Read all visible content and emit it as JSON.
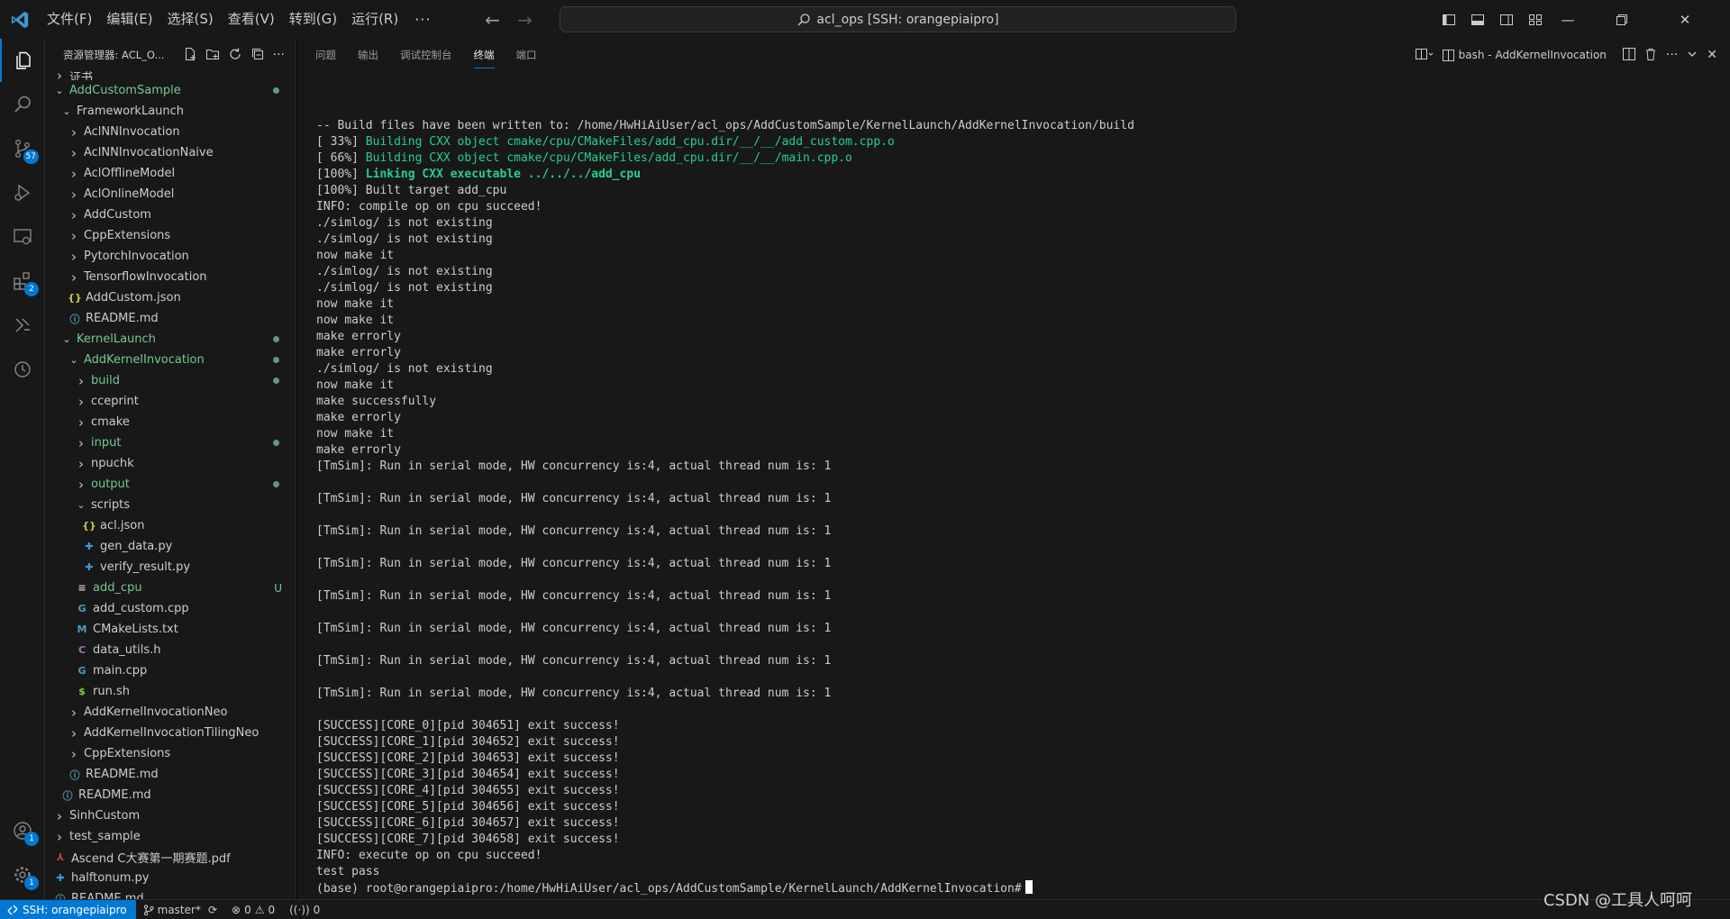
{
  "titlebar": {
    "menus": [
      "文件(F)",
      "编辑(E)",
      "选择(S)",
      "查看(V)",
      "转到(G)",
      "运行(R)"
    ],
    "more": "···",
    "search_text": "acl_ops [SSH: orangepiaipro]"
  },
  "activity": {
    "scm_badge": "57",
    "extensions_badge": "2",
    "accounts_badge": "1",
    "settings_badge": "1"
  },
  "sidebar": {
    "title": "资源管理器: ACL_O...",
    "items": [
      {
        "label": "证书",
        "depth": 1,
        "type": "folder-closed",
        "color": "",
        "mark": ""
      },
      {
        "label": "AddCustomSample",
        "depth": 1,
        "type": "folder-open",
        "color": "green",
        "mark": "dot"
      },
      {
        "label": "FrameworkLaunch",
        "depth": 2,
        "type": "folder-open",
        "color": "",
        "mark": ""
      },
      {
        "label": "AclNNInvocation",
        "depth": 3,
        "type": "folder-closed",
        "color": "",
        "mark": ""
      },
      {
        "label": "AclNNInvocationNaive",
        "depth": 3,
        "type": "folder-closed",
        "color": "",
        "mark": ""
      },
      {
        "label": "AclOfflineModel",
        "depth": 3,
        "type": "folder-closed",
        "color": "",
        "mark": ""
      },
      {
        "label": "AclOnlineModel",
        "depth": 3,
        "type": "folder-closed",
        "color": "",
        "mark": ""
      },
      {
        "label": "AddCustom",
        "depth": 3,
        "type": "folder-closed",
        "color": "",
        "mark": ""
      },
      {
        "label": "CppExtensions",
        "depth": 3,
        "type": "folder-closed",
        "color": "",
        "mark": ""
      },
      {
        "label": "PytorchInvocation",
        "depth": 3,
        "type": "folder-closed",
        "color": "",
        "mark": ""
      },
      {
        "label": "TensorflowInvocation",
        "depth": 3,
        "type": "folder-closed",
        "color": "",
        "mark": ""
      },
      {
        "label": "AddCustom.json",
        "depth": 3,
        "type": "json",
        "color": "",
        "mark": ""
      },
      {
        "label": "README.md",
        "depth": 3,
        "type": "info",
        "color": "",
        "mark": ""
      },
      {
        "label": "KernelLaunch",
        "depth": 2,
        "type": "folder-open",
        "color": "green",
        "mark": "dot"
      },
      {
        "label": "AddKernelInvocation",
        "depth": 3,
        "type": "folder-open",
        "color": "green",
        "mark": "dot"
      },
      {
        "label": "build",
        "depth": 4,
        "type": "folder-closed",
        "color": "green",
        "mark": "dot"
      },
      {
        "label": "cceprint",
        "depth": 4,
        "type": "folder-closed",
        "color": "",
        "mark": ""
      },
      {
        "label": "cmake",
        "depth": 4,
        "type": "folder-closed",
        "color": "",
        "mark": ""
      },
      {
        "label": "input",
        "depth": 4,
        "type": "folder-closed",
        "color": "green",
        "mark": "dot"
      },
      {
        "label": "npuchk",
        "depth": 4,
        "type": "folder-closed",
        "color": "",
        "mark": ""
      },
      {
        "label": "output",
        "depth": 4,
        "type": "folder-closed",
        "color": "green",
        "mark": "dot"
      },
      {
        "label": "scripts",
        "depth": 4,
        "type": "folder-open",
        "color": "",
        "mark": ""
      },
      {
        "label": "acl.json",
        "depth": 5,
        "type": "json",
        "color": "",
        "mark": ""
      },
      {
        "label": "gen_data.py",
        "depth": 5,
        "type": "python",
        "color": "",
        "mark": ""
      },
      {
        "label": "verify_result.py",
        "depth": 5,
        "type": "python",
        "color": "",
        "mark": ""
      },
      {
        "label": "add_cpu",
        "depth": 4,
        "type": "text",
        "color": "green",
        "mark": "U"
      },
      {
        "label": "add_custom.cpp",
        "depth": 4,
        "type": "cpp",
        "color": "",
        "mark": ""
      },
      {
        "label": "CMakeLists.txt",
        "depth": 4,
        "type": "cmake",
        "color": "",
        "mark": ""
      },
      {
        "label": "data_utils.h",
        "depth": 4,
        "type": "c",
        "color": "",
        "mark": ""
      },
      {
        "label": "main.cpp",
        "depth": 4,
        "type": "cpp",
        "color": "",
        "mark": ""
      },
      {
        "label": "run.sh",
        "depth": 4,
        "type": "shell",
        "color": "",
        "mark": ""
      },
      {
        "label": "AddKernelInvocationNeo",
        "depth": 3,
        "type": "folder-closed",
        "color": "",
        "mark": ""
      },
      {
        "label": "AddKernelInvocationTilingNeo",
        "depth": 3,
        "type": "folder-closed",
        "color": "",
        "mark": ""
      },
      {
        "label": "CppExtensions",
        "depth": 3,
        "type": "folder-closed",
        "color": "",
        "mark": ""
      },
      {
        "label": "README.md",
        "depth": 3,
        "type": "info",
        "color": "",
        "mark": ""
      },
      {
        "label": "README.md",
        "depth": 2,
        "type": "info",
        "color": "",
        "mark": ""
      },
      {
        "label": "SinhCustom",
        "depth": 1,
        "type": "folder-closed",
        "color": "",
        "mark": ""
      },
      {
        "label": "test_sample",
        "depth": 1,
        "type": "folder-closed",
        "color": "",
        "mark": ""
      },
      {
        "label": "Ascend C大赛第一期赛题.pdf",
        "depth": 1,
        "type": "pdf",
        "color": "",
        "mark": ""
      },
      {
        "label": "halftonum.py",
        "depth": 1,
        "type": "python",
        "color": "",
        "mark": ""
      },
      {
        "label": "README.md",
        "depth": 1,
        "type": "info",
        "color": "",
        "mark": ""
      }
    ]
  },
  "panel": {
    "tabs": [
      "问题",
      "输出",
      "调试控制台",
      "终端",
      "端口"
    ],
    "active_tab": "终端",
    "terminal_name": "bash - AddKernelInvocation"
  },
  "terminal": {
    "lines": [
      {
        "text": "-- Build files have been written to: /home/HwHiAiUser/acl_ops/AddCustomSample/KernelLaunch/AddKernelInvocation/build",
        "style": ""
      },
      {
        "prefix": "[ 33%] ",
        "text": "Building CXX object cmake/cpu/CMakeFiles/add_cpu.dir/__/__/add_custom.cpp.o",
        "style": "green"
      },
      {
        "prefix": "[ 66%] ",
        "text": "Building CXX object cmake/cpu/CMakeFiles/add_cpu.dir/__/__/main.cpp.o",
        "style": "green"
      },
      {
        "prefix": "[100%] ",
        "text": "Linking CXX executable ../../../add_cpu",
        "style": "bold-green"
      },
      {
        "text": "[100%] Built target add_cpu",
        "style": ""
      },
      {
        "text": "INFO: compile op on cpu succeed!",
        "style": ""
      },
      {
        "text": "./simlog/ is not existing",
        "style": ""
      },
      {
        "text": "./simlog/ is not existing",
        "style": ""
      },
      {
        "text": "now make it",
        "style": ""
      },
      {
        "text": "./simlog/ is not existing",
        "style": ""
      },
      {
        "text": "./simlog/ is not existing",
        "style": ""
      },
      {
        "text": "now make it",
        "style": ""
      },
      {
        "text": "now make it",
        "style": ""
      },
      {
        "text": "make errorly",
        "style": ""
      },
      {
        "text": "make errorly",
        "style": ""
      },
      {
        "text": "./simlog/ is not existing",
        "style": ""
      },
      {
        "text": "now make it",
        "style": ""
      },
      {
        "text": "make successfully",
        "style": ""
      },
      {
        "text": "make errorly",
        "style": ""
      },
      {
        "text": "now make it",
        "style": ""
      },
      {
        "text": "make errorly",
        "style": ""
      },
      {
        "text": "[TmSim]: Run in serial mode, HW concurrency is:4, actual thread num is: 1",
        "style": ""
      },
      {
        "text": "",
        "style": ""
      },
      {
        "text": "[TmSim]: Run in serial mode, HW concurrency is:4, actual thread num is: 1",
        "style": ""
      },
      {
        "text": "",
        "style": ""
      },
      {
        "text": "[TmSim]: Run in serial mode, HW concurrency is:4, actual thread num is: 1",
        "style": ""
      },
      {
        "text": "",
        "style": ""
      },
      {
        "text": "[TmSim]: Run in serial mode, HW concurrency is:4, actual thread num is: 1",
        "style": ""
      },
      {
        "text": "",
        "style": ""
      },
      {
        "text": "[TmSim]: Run in serial mode, HW concurrency is:4, actual thread num is: 1",
        "style": ""
      },
      {
        "text": "",
        "style": ""
      },
      {
        "text": "[TmSim]: Run in serial mode, HW concurrency is:4, actual thread num is: 1",
        "style": ""
      },
      {
        "text": "",
        "style": ""
      },
      {
        "text": "[TmSim]: Run in serial mode, HW concurrency is:4, actual thread num is: 1",
        "style": ""
      },
      {
        "text": "",
        "style": ""
      },
      {
        "text": "[TmSim]: Run in serial mode, HW concurrency is:4, actual thread num is: 1",
        "style": ""
      },
      {
        "text": "",
        "style": ""
      },
      {
        "text": "[SUCCESS][CORE_0][pid 304651] exit success!",
        "style": ""
      },
      {
        "text": "[SUCCESS][CORE_1][pid 304652] exit success!",
        "style": ""
      },
      {
        "text": "[SUCCESS][CORE_2][pid 304653] exit success!",
        "style": ""
      },
      {
        "text": "[SUCCESS][CORE_3][pid 304654] exit success!",
        "style": ""
      },
      {
        "text": "[SUCCESS][CORE_4][pid 304655] exit success!",
        "style": ""
      },
      {
        "text": "[SUCCESS][CORE_5][pid 304656] exit success!",
        "style": ""
      },
      {
        "text": "[SUCCESS][CORE_6][pid 304657] exit success!",
        "style": ""
      },
      {
        "text": "[SUCCESS][CORE_7][pid 304658] exit success!",
        "style": ""
      },
      {
        "text": "INFO: execute op on cpu succeed!",
        "style": ""
      },
      {
        "text": "test pass",
        "style": ""
      }
    ],
    "prompt": "(base) root@orangepiaipro:/home/HwHiAiUser/acl_ops/AddCustomSample/KernelLaunch/AddKernelInvocation#"
  },
  "statusbar": {
    "remote": "SSH: orangepiaipro",
    "branch": "master*",
    "errors": "0",
    "warnings": "0",
    "ports": "0"
  },
  "watermark": "CSDN @工具人呵呵"
}
